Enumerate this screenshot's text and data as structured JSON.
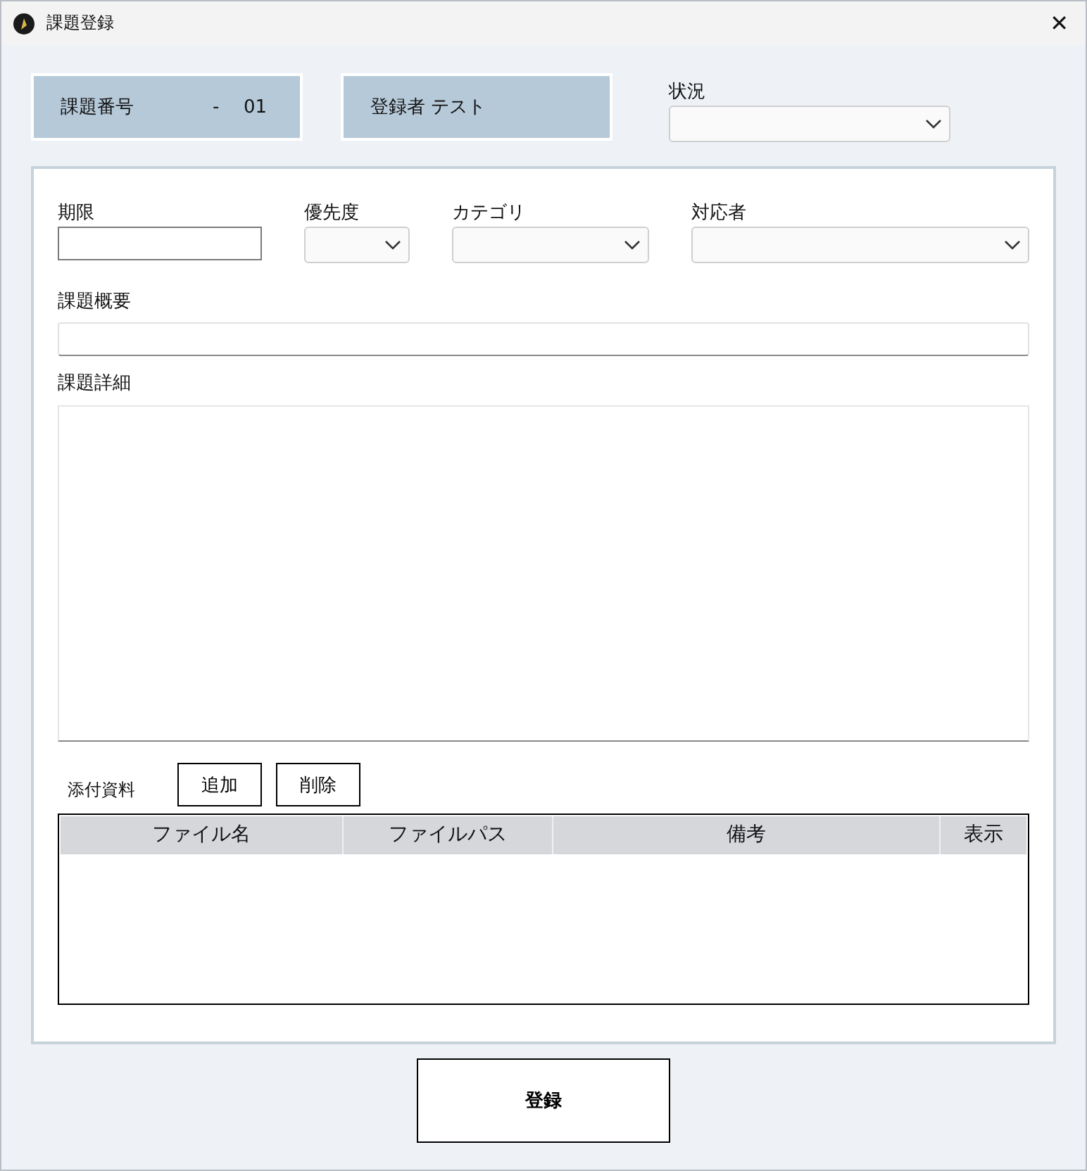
{
  "window": {
    "title": "課題登録",
    "close": "✕"
  },
  "header": {
    "number_label": "課題番号",
    "number_separator": "-",
    "number_value": "01",
    "registrant_label": "登録者",
    "registrant_value": "テスト",
    "status_label": "状況"
  },
  "fields": [
    {
      "kind": "text",
      "label": "期限"
    },
    {
      "kind": "combo",
      "label": "優先度"
    },
    {
      "kind": "combo",
      "label": "カテゴリ"
    },
    {
      "kind": "combo",
      "label": "対応者"
    }
  ],
  "summary": {
    "label": "課題概要"
  },
  "details": {
    "label": "課題詳細"
  },
  "attachments": {
    "label": "添付資料",
    "buttons": [
      "追加",
      "削除"
    ],
    "columns": [
      "ファイル名",
      "ファイルパス",
      "備考",
      "表示"
    ]
  },
  "submit": "登録"
}
